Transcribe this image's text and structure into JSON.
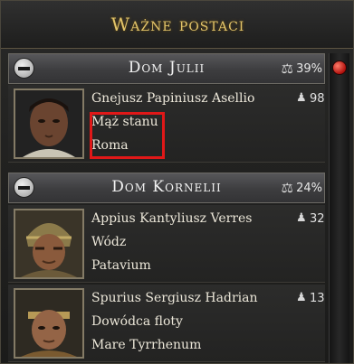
{
  "panel": {
    "title": "Ważne postaci"
  },
  "houses": [
    {
      "name": "Dom Julii",
      "percent": "39%",
      "characters": [
        {
          "name": "Gnejusz Papiniusz Asellio",
          "role": "Mąż stanu",
          "location": "Roma",
          "value": "98",
          "highlighted": true
        }
      ]
    },
    {
      "name": "Dom Kornelii",
      "percent": "24%",
      "characters": [
        {
          "name": "Appius Kantyliusz Verres",
          "role": "Wódz",
          "location": "Patavium",
          "value": "32",
          "highlighted": false
        },
        {
          "name": "Spurius Sergiusz Hadrian",
          "role": "Dowódca floty",
          "location": "Mare Tyrrhenum",
          "value": "13",
          "highlighted": false
        }
      ]
    }
  ],
  "icons": {
    "collapse": "minus-circle-icon",
    "influence": "scales-icon",
    "character_value": "bust-icon",
    "scroll": "scroll-knob"
  },
  "colors": {
    "title_gold": "#e2c469",
    "highlight_red": "#e01818",
    "scroll_red": "#b0100c"
  }
}
